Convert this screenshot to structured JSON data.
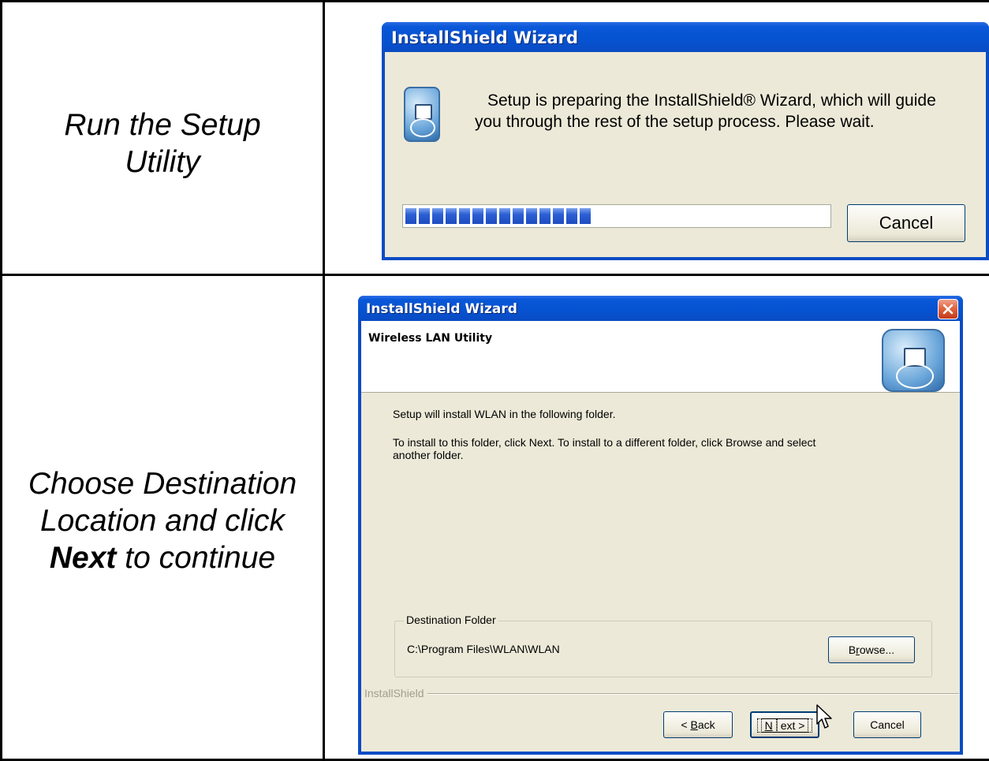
{
  "rows": [
    {
      "caption_lines": [
        "Run the Setup",
        "Utility"
      ]
    },
    {
      "caption_lines": [
        "Choose Destination",
        "Location and click"
      ],
      "caption_bold": "Next",
      "caption_tail": " to continue"
    }
  ],
  "dialog1": {
    "title": "InstallShield Wizard",
    "message_line1": "Setup is preparing the InstallShield® Wizard, which will guide",
    "message_line2": "you through the rest of the setup process. Please wait.",
    "progress_fraction": 0.44,
    "cancel_label": "Cancel"
  },
  "dialog2": {
    "title": "InstallShield Wizard",
    "header_title": "Wireless LAN Utility",
    "text1": "Setup will install WLAN in the following folder.",
    "text2_line1": "To install to this folder, click Next. To install to a different folder, click Browse and select",
    "text2_line2": "another folder.",
    "group_label": "Destination Folder",
    "folder_path": "C:\\Program Files\\WLAN\\WLAN",
    "browse_label_pre": "B",
    "browse_label_ul": "r",
    "browse_label_post": "owse...",
    "brand": "InstallShield",
    "back_label_pre": "< ",
    "back_label_ul": "B",
    "back_label_post": "ack",
    "next_label_ul": "N",
    "next_label_post": "ext >",
    "cancel_label": "Cancel"
  },
  "icons": [
    "installer-icon",
    "close-icon",
    "mouse-cursor-icon"
  ],
  "colors": {
    "titlebar": "#0a58d8",
    "dialog_bg": "#ece9d8",
    "progress": "#2c5fd4"
  }
}
